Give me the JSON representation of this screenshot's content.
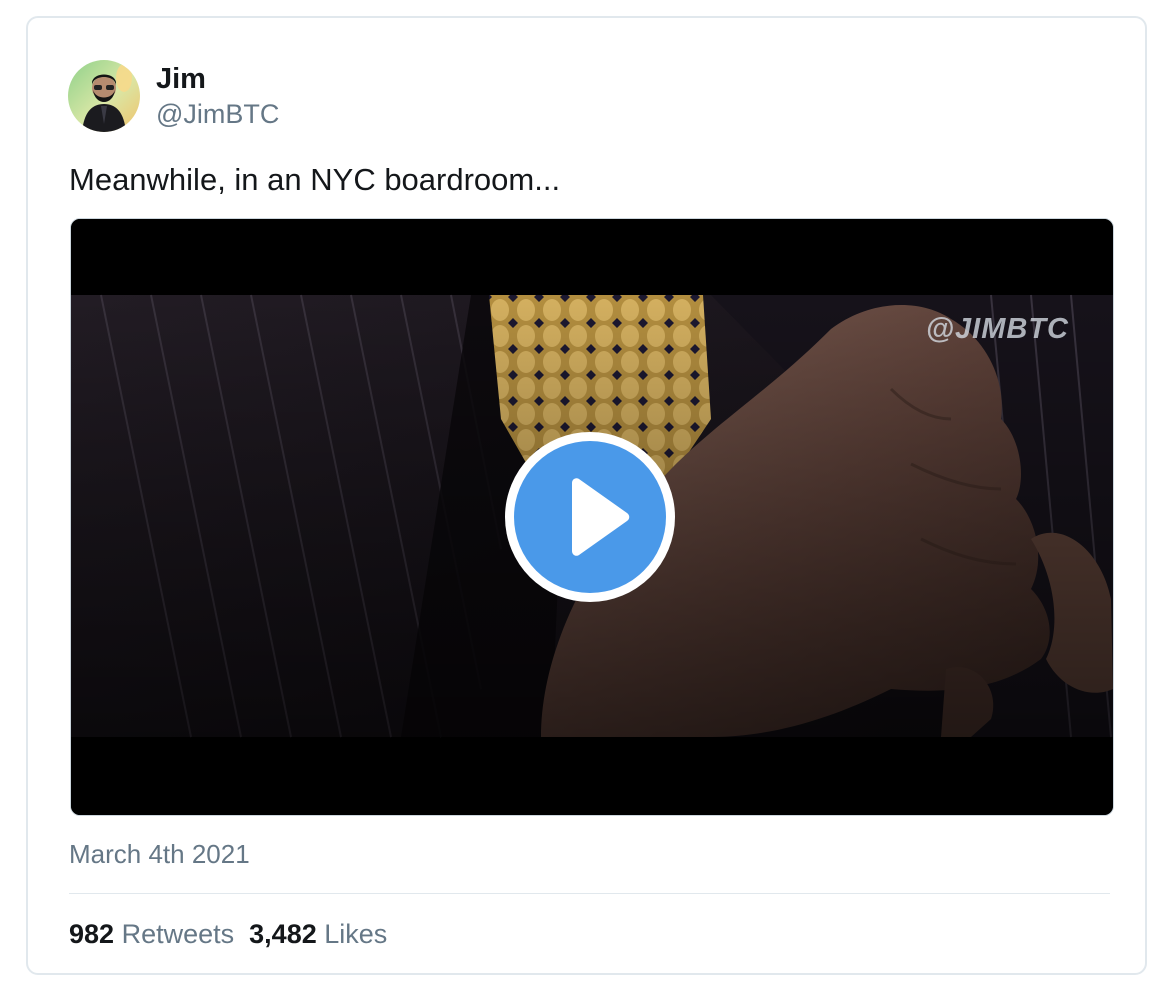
{
  "tweet": {
    "author": {
      "name": "Jim",
      "handle": "@JimBTC"
    },
    "text": "Meanwhile, in an NYC boardroom...",
    "media": {
      "type": "video",
      "watermark": "@JIMBTC",
      "play_icon": "play-icon"
    },
    "date": "March 4th 2021",
    "stats": {
      "retweets_count": "982",
      "retweets_label": "Retweets",
      "likes_count": "3,482",
      "likes_label": "Likes"
    }
  },
  "colors": {
    "accent": "#4a99e9",
    "text_primary": "#14171a",
    "text_secondary": "#657786",
    "border": "#e1e8ed"
  }
}
